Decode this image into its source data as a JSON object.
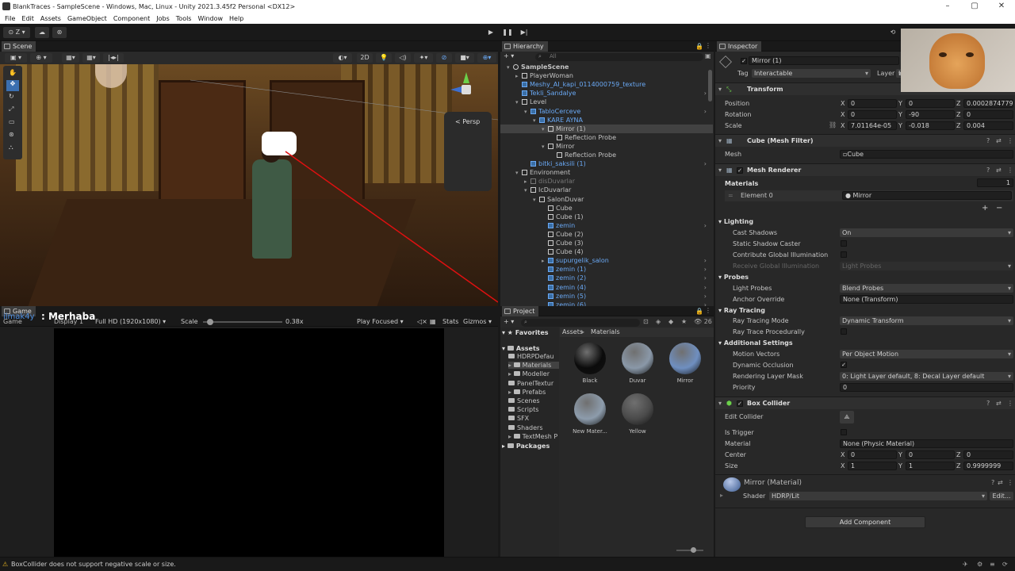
{
  "window": {
    "title": "BlankTraces - SampleScene - Windows, Mac, Linux - Unity 2021.3.45f2 Personal <DX12>"
  },
  "menu": [
    "File",
    "Edit",
    "Assets",
    "GameObject",
    "Component",
    "Jobs",
    "Tools",
    "Window",
    "Help"
  ],
  "toolbar": {
    "account": "Z"
  },
  "scene": {
    "tab": "Scene",
    "mode_2d": "2D",
    "persp": "< Persp"
  },
  "game": {
    "tab": "Game",
    "subtab": "Game",
    "display": "Display 1",
    "resolution": "Full HD (1920x1080)",
    "scale_label": "Scale",
    "scale_value": "0.38x",
    "scale_fraction": 0.05,
    "play_mode": "Play Focused",
    "stats": "Stats",
    "gizmos": "Gizmos",
    "overlay_user": "ilmak4y",
    "overlay_message": ": Merhaba"
  },
  "hierarchy": {
    "tab": "Hierarchy",
    "search_placeholder": "All",
    "rows": [
      {
        "label": "SampleScene",
        "indent": 0,
        "style": "scene",
        "arrow": "▾"
      },
      {
        "label": "PlayerWoman",
        "indent": 1,
        "style": "normal",
        "arrow": "▸"
      },
      {
        "label": "Meshy_AI_kapi_0114000759_texture",
        "indent": 1,
        "style": "blue",
        "arrow": ""
      },
      {
        "label": "Tekli_Sandalye",
        "indent": 1,
        "style": "blue",
        "arrow": ""
      },
      {
        "label": "Level",
        "indent": 1,
        "style": "normal",
        "arrow": "▾"
      },
      {
        "label": "TabloCerceve",
        "indent": 2,
        "style": "blue",
        "arrow": "▾"
      },
      {
        "label": "KARE AYNA",
        "indent": 3,
        "style": "blue",
        "arrow": "▾"
      },
      {
        "label": "Mirror (1)",
        "indent": 4,
        "style": "sel",
        "arrow": "▾"
      },
      {
        "label": "Reflection Probe",
        "indent": 5,
        "style": "normal",
        "arrow": ""
      },
      {
        "label": "Mirror",
        "indent": 4,
        "style": "normal",
        "arrow": "▾"
      },
      {
        "label": "Reflection Probe",
        "indent": 5,
        "style": "normal",
        "arrow": ""
      },
      {
        "label": "bitki_saksili (1)",
        "indent": 2,
        "style": "blue",
        "arrow": ""
      },
      {
        "label": "Environment",
        "indent": 1,
        "style": "normal",
        "arrow": "▾"
      },
      {
        "label": "disDuvarlar",
        "indent": 2,
        "style": "gray",
        "arrow": "▸"
      },
      {
        "label": "IcDuvarlar",
        "indent": 2,
        "style": "normal",
        "arrow": "▾"
      },
      {
        "label": "SalonDuvar",
        "indent": 3,
        "style": "normal",
        "arrow": "▾"
      },
      {
        "label": "Cube",
        "indent": 4,
        "style": "normal",
        "arrow": ""
      },
      {
        "label": "Cube (1)",
        "indent": 4,
        "style": "normal",
        "arrow": ""
      },
      {
        "label": "zemin",
        "indent": 4,
        "style": "blue",
        "arrow": ""
      },
      {
        "label": "Cube (2)",
        "indent": 4,
        "style": "normal",
        "arrow": ""
      },
      {
        "label": "Cube (3)",
        "indent": 4,
        "style": "normal",
        "arrow": ""
      },
      {
        "label": "Cube (4)",
        "indent": 4,
        "style": "normal",
        "arrow": ""
      },
      {
        "label": "supurgelik_salon",
        "indent": 4,
        "style": "blue",
        "arrow": "▸"
      },
      {
        "label": "zemin (1)",
        "indent": 4,
        "style": "blue",
        "arrow": ""
      },
      {
        "label": "zemin (2)",
        "indent": 4,
        "style": "blue",
        "arrow": ""
      },
      {
        "label": "zemin (4)",
        "indent": 4,
        "style": "blue",
        "arrow": ""
      },
      {
        "label": "zemin (5)",
        "indent": 4,
        "style": "blue",
        "arrow": ""
      },
      {
        "label": "zemin (6)",
        "indent": 4,
        "style": "blue",
        "arrow": ""
      }
    ]
  },
  "project": {
    "tab": "Project",
    "favorites": "Favorites",
    "assets": "Assets",
    "folders": [
      "HDRPDefau",
      "Materials",
      "Modeller",
      "PanelTextur",
      "Prefabs",
      "Scenes",
      "Scripts",
      "SFX",
      "Shaders",
      "TextMesh P"
    ],
    "packages": "Packages",
    "breadcrumb_root": "Assets",
    "breadcrumb_sep": "▸",
    "breadcrumb_current": "Materials",
    "count": "26",
    "materials": [
      {
        "name": "Black",
        "color": "#0b0b0b"
      },
      {
        "name": "Duvar",
        "color": "#8a98a8"
      },
      {
        "name": "Mirror",
        "color": "#6f8fc0"
      },
      {
        "name": "New Mater...",
        "color": "#8d9cac"
      },
      {
        "name": "Yellow",
        "color": "#4a4a4a"
      }
    ]
  },
  "inspector": {
    "tab": "Inspector",
    "object_name": "Mirror (1)",
    "tag_label": "Tag",
    "tag_value": "Interactable",
    "layer_label": "Layer",
    "layer_value": "L",
    "transform": {
      "title": "Transform",
      "position_label": "Position",
      "position": [
        "0",
        "0",
        "0.0002874779"
      ],
      "rotation_label": "Rotation",
      "rotation": [
        "0",
        "-90",
        "0"
      ],
      "scale_label": "Scale",
      "scale": [
        "7.01164e-05",
        "-0.018",
        "0.004"
      ]
    },
    "mesh_filter": {
      "title": "Cube (Mesh Filter)",
      "mesh_label": "Mesh",
      "mesh_value": "Cube"
    },
    "mesh_renderer": {
      "title": "Mesh Renderer",
      "materials_label": "Materials",
      "materials_count": "1",
      "element_label": "Element 0",
      "element_value": "Mirror",
      "lighting": "Lighting",
      "cast_shadows_label": "Cast Shadows",
      "cast_shadows_value": "On",
      "static_shadow_label": "Static Shadow Caster",
      "contribute_gi_label": "Contribute Global Illumination",
      "receive_gi_label": "Receive Global Illumination",
      "receive_gi_value": "Light Probes",
      "probes": "Probes",
      "light_probes_label": "Light Probes",
      "light_probes_value": "Blend Probes",
      "anchor_label": "Anchor Override",
      "anchor_value": "None (Transform)",
      "ray_tracing": "Ray Tracing",
      "rt_mode_label": "Ray Tracing Mode",
      "rt_mode_value": "Dynamic Transform",
      "rt_proc_label": "Ray Trace Procedurally",
      "additional": "Additional Settings",
      "motion_label": "Motion Vectors",
      "motion_value": "Per Object Motion",
      "occlusion_label": "Dynamic Occlusion",
      "layer_mask_label": "Rendering Layer Mask",
      "layer_mask_value": "0: Light Layer default, 8: Decal Layer default",
      "priority_label": "Priority",
      "priority_value": "0"
    },
    "box_collider": {
      "title": "Box Collider",
      "edit_label": "Edit Collider",
      "trigger_label": "Is Trigger",
      "material_label": "Material",
      "material_value": "None (Physic Material)",
      "center_label": "Center",
      "center": [
        "0",
        "0",
        "0"
      ],
      "size_label": "Size",
      "size": [
        "1",
        "1",
        "0.9999999"
      ]
    },
    "material": {
      "title": "Mirror (Material)",
      "shader_label": "Shader",
      "shader_value": "HDRP/Lit",
      "edit": "Edit..."
    },
    "add_component": "Add Component"
  },
  "status": {
    "message": "BoxCollider does not support negative scale or size."
  }
}
